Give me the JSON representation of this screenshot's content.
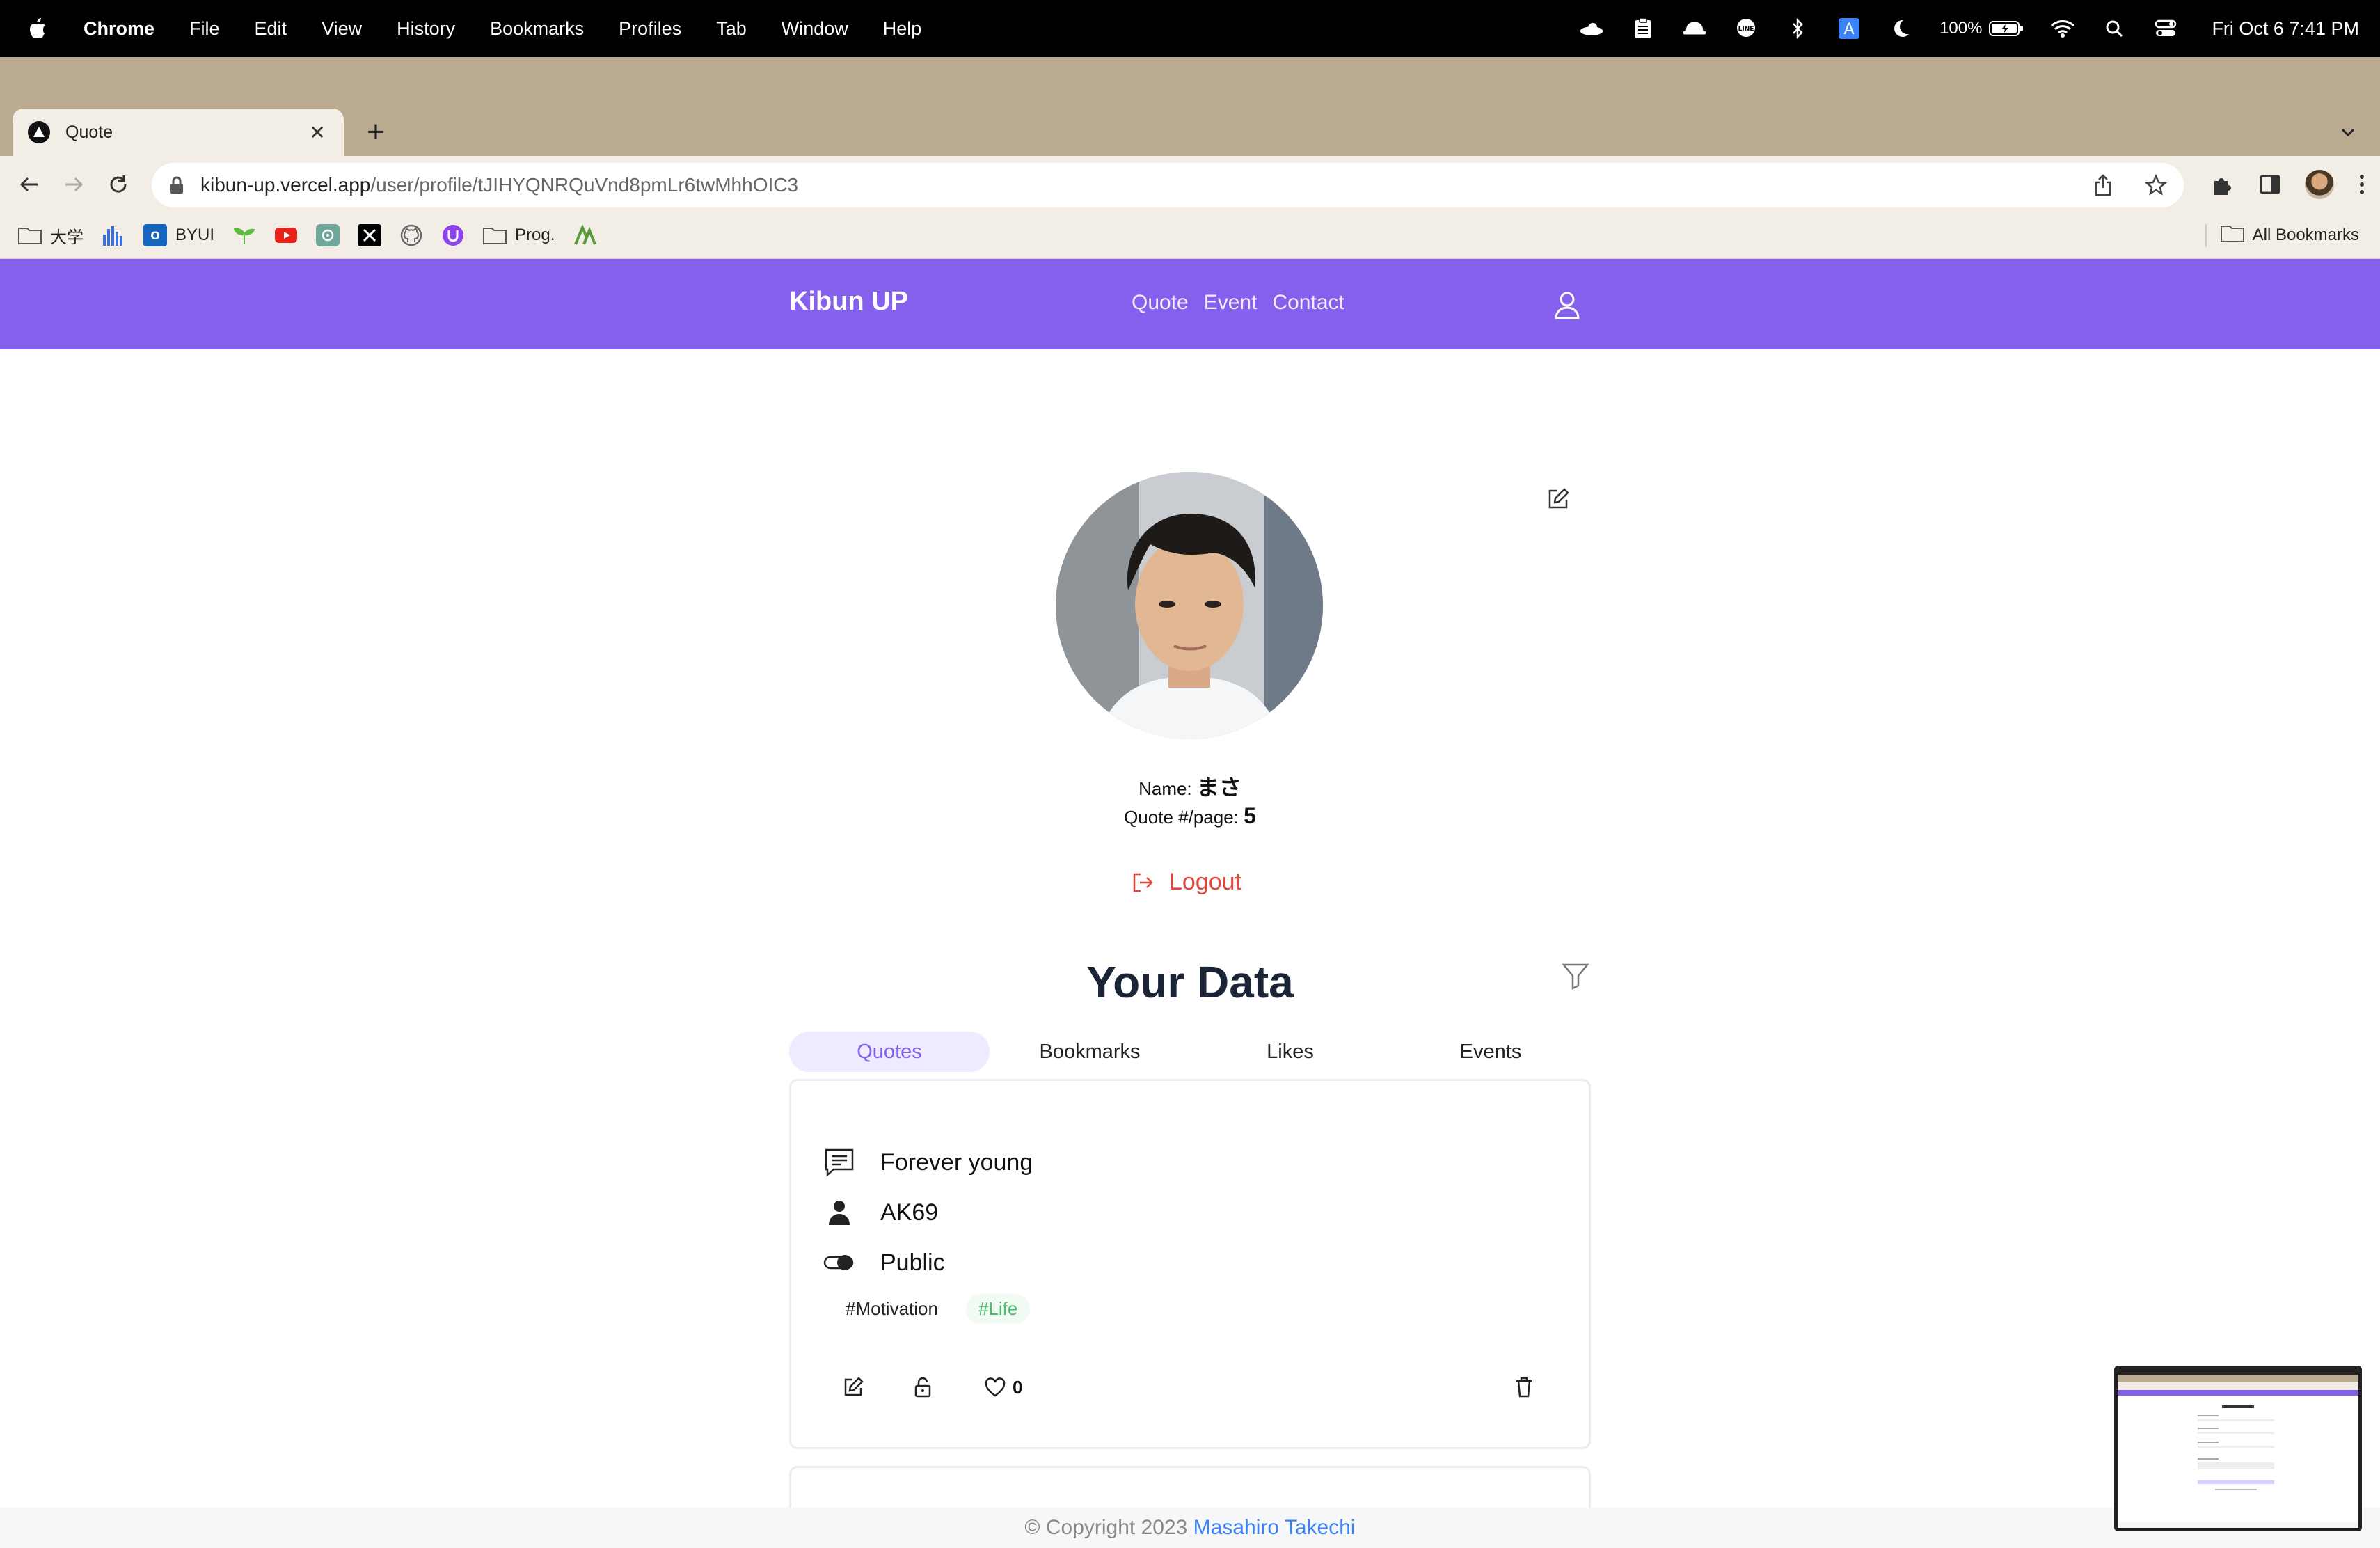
{
  "menubar": {
    "app_name": "Chrome",
    "items": [
      "File",
      "Edit",
      "View",
      "History",
      "Bookmarks",
      "Profiles",
      "Tab",
      "Window",
      "Help"
    ],
    "battery": "100%",
    "clock": "Fri Oct 6  7:41 PM"
  },
  "browser": {
    "tab_title": "Quote",
    "url_host": "kibun-up.vercel.app",
    "url_path": "/user/profile/tJIHYQNRQuVnd8pmLr6twMhhOIC3",
    "bookmarks": [
      {
        "label": "大学",
        "icon": "folder-icon"
      },
      {
        "label": "",
        "icon": "chart-icon"
      },
      {
        "label": "BYUI",
        "icon": "outlook-icon"
      },
      {
        "label": "",
        "icon": "sprout-icon"
      },
      {
        "label": "",
        "icon": "youtube-icon"
      },
      {
        "label": "",
        "icon": "chatgpt-icon"
      },
      {
        "label": "",
        "icon": "x-icon"
      },
      {
        "label": "",
        "icon": "github-icon"
      },
      {
        "label": "",
        "icon": "udemy-icon"
      },
      {
        "label": "Prog.",
        "icon": "folder-icon"
      },
      {
        "label": "",
        "icon": "app-icon"
      }
    ],
    "all_bookmarks": "All Bookmarks"
  },
  "site": {
    "logo": "Kibun UP",
    "nav": [
      "Quote",
      "Event",
      "Contact"
    ]
  },
  "profile": {
    "name_label": "Name:",
    "name_value": "まさ",
    "quotes_label": "Quote #/page:",
    "quotes_value": "5",
    "logout": "Logout"
  },
  "data_section": {
    "title": "Your Data",
    "tabs": [
      "Quotes",
      "Bookmarks",
      "Likes",
      "Events"
    ],
    "active_tab": "Quotes"
  },
  "quote_card": {
    "text": "Forever young",
    "author": "AK69",
    "visibility": "Public",
    "tags": [
      "#Motivation",
      "#Life"
    ],
    "likes": "0"
  },
  "footer": {
    "copyright": "© Copyright 2023",
    "author": "Masahiro Takechi"
  },
  "colors": {
    "brand": "#8560ec",
    "logout": "#e0463a",
    "link": "#3b82f6",
    "tag_green": "#4cbf6b"
  }
}
